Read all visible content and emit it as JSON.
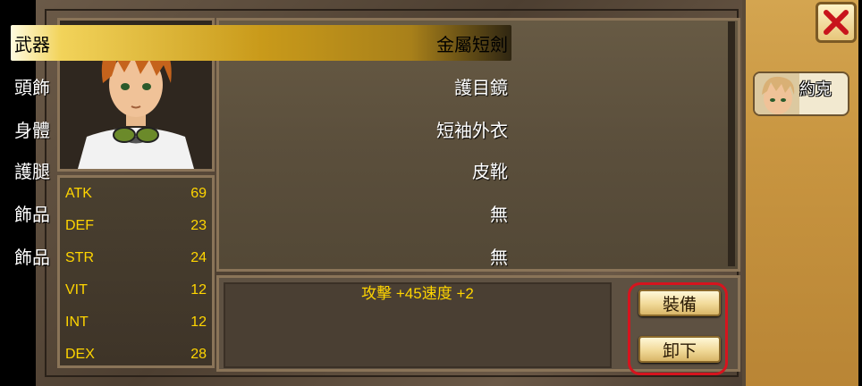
{
  "stats": [
    {
      "label": "ATK",
      "value": "69"
    },
    {
      "label": "DEF",
      "value": "23"
    },
    {
      "label": "STR",
      "value": "24"
    },
    {
      "label": "VIT",
      "value": "12"
    },
    {
      "label": "INT",
      "value": "12"
    },
    {
      "label": "DEX",
      "value": "28"
    }
  ],
  "equipment": [
    {
      "slot": "武器",
      "item": "金屬短劍",
      "selected": true
    },
    {
      "slot": "頭飾",
      "item": "護目鏡"
    },
    {
      "slot": "身體",
      "item": "短袖外衣"
    },
    {
      "slot": "護腿",
      "item": "皮靴"
    },
    {
      "slot": "飾品",
      "item": "無"
    },
    {
      "slot": "飾品",
      "item": "無"
    }
  ],
  "description": "攻擊 +45速度 +2",
  "buttons": {
    "equip": "裝備",
    "unequip": "卸下"
  },
  "character_tab": {
    "name": "約克"
  },
  "icons": {
    "close": "close-x-icon"
  },
  "colors": {
    "stat_text": "#ffd500",
    "highlight": "#d6141e"
  }
}
